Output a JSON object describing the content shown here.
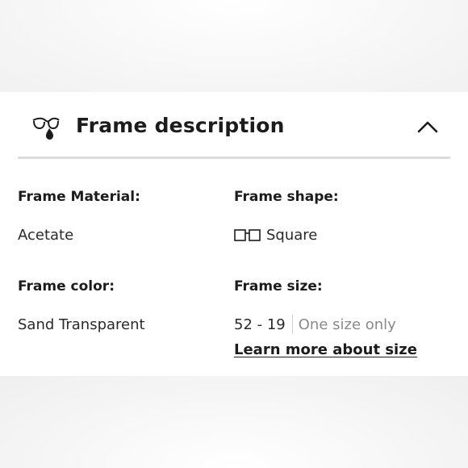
{
  "section": {
    "title": "Frame description",
    "icon": "glasses-drop-icon",
    "toggle_icon": "chevron-up-icon"
  },
  "details": {
    "material": {
      "label": "Frame Material:",
      "value": "Acetate"
    },
    "shape": {
      "label": "Frame shape:",
      "value": "Square",
      "icon": "square-frame-icon"
    },
    "color": {
      "label": "Frame color:",
      "value": "Sand Transparent"
    },
    "size": {
      "label": "Frame size:",
      "measure": "52 - 19",
      "note": "One size only",
      "link": "Learn more about size"
    }
  },
  "colors": {
    "text": "#1c1c1c",
    "muted": "#8a8a8a",
    "divider": "#dcdcdc"
  }
}
